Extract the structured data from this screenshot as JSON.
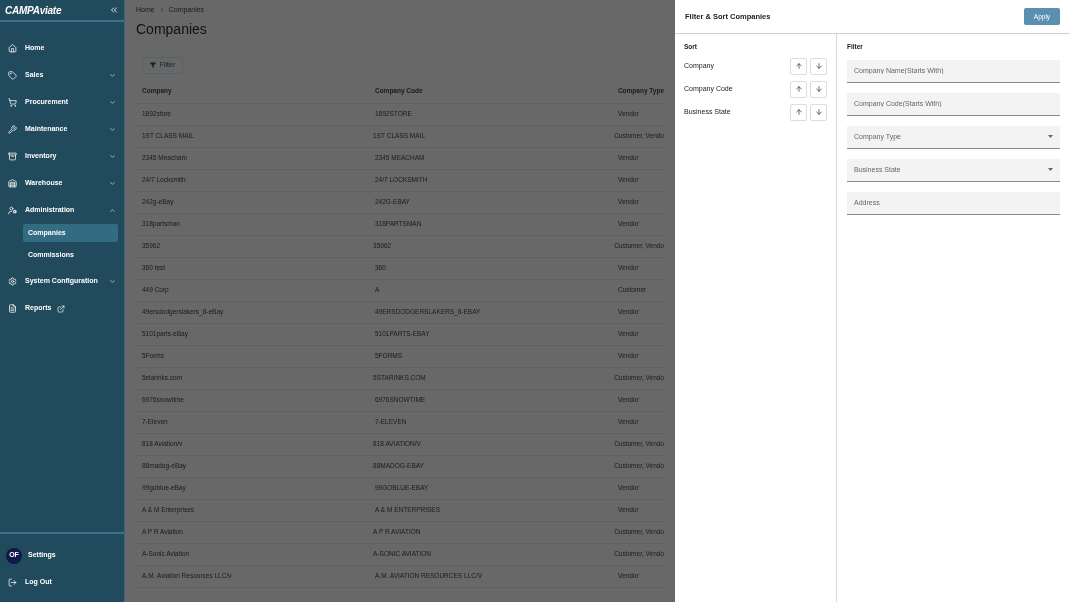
{
  "sidebar": {
    "logo": [
      "CAMP",
      "Aviate"
    ],
    "items": [
      {
        "label": "Home",
        "expandable": false,
        "external": false
      },
      {
        "label": "Sales",
        "expandable": true,
        "expanded": false
      },
      {
        "label": "Procurement",
        "expandable": true,
        "expanded": false
      },
      {
        "label": "Maintenance",
        "expandable": true,
        "expanded": false
      },
      {
        "label": "Inventory",
        "expandable": true,
        "expanded": false
      },
      {
        "label": "Warehouse",
        "expandable": true,
        "expanded": false
      },
      {
        "label": "Administration",
        "expandable": true,
        "expanded": true,
        "children": [
          {
            "label": "Companies",
            "selected": true
          },
          {
            "label": "Commissions",
            "selected": false
          }
        ]
      },
      {
        "label": "System Configuration",
        "expandable": true,
        "expanded": false
      },
      {
        "label": "Reports",
        "expandable": false,
        "external": true
      }
    ],
    "footer": {
      "avatar": "OF",
      "settings": "Settings",
      "logout": "Log Out"
    }
  },
  "breadcrumb": [
    "Home",
    "Companies"
  ],
  "page_title": "Companies",
  "filter_button": "Filter",
  "table": {
    "columns": [
      "Company",
      "Company Code",
      "Company Type"
    ],
    "rows": [
      [
        "1892store",
        "1892STORE",
        "Vendor"
      ],
      [
        "1ST CLASS MAIL",
        "1ST CLASS MAIL",
        "Customer, Vendo"
      ],
      [
        "2345 Meacham",
        "2345 MEACHAM",
        "Vendor"
      ],
      [
        "24/7 Locksmith",
        "24/7 LOCKSMITH",
        "Vendor"
      ],
      [
        "242g-eBay",
        "242G-EBAY",
        "Vendor"
      ],
      [
        "318partsman",
        "318PARTSMAN",
        "Vendor"
      ],
      [
        "35962",
        "35962",
        "Customer, Vendo"
      ],
      [
        "360 test",
        "360",
        "Vendor"
      ],
      [
        "449 Corp",
        "A",
        "Customer"
      ],
      [
        "49ersdodgerslakers_8-eBay",
        "49ERSDODGERSLAKERS_8-EBAY",
        "Vendor"
      ],
      [
        "5101parts-eBay",
        "5101PARTS-EBAY",
        "Vendor"
      ],
      [
        "5Forms",
        "5FORMS",
        "Vendor"
      ],
      [
        "5starinks.com",
        "5STARINKS.COM",
        "Customer, Vendo"
      ],
      [
        "6976snowtime",
        "6976SNOWTIME",
        "Vendor"
      ],
      [
        "7-Eleven",
        "7-ELEVEN",
        "Vendor"
      ],
      [
        "818 Aviation/v",
        "818 AVIATION/V",
        "Customer, Vendo"
      ],
      [
        "88madog-eBay",
        "88MADOG-EBAY",
        "Customer, Vendo"
      ],
      [
        "99goblue-eBay",
        "99GOBLUE-EBAY",
        "Vendor"
      ],
      [
        "A & M Enterprises",
        "A & M ENTERPRISES",
        "Vendor"
      ],
      [
        "A P R Aviation",
        "A P R AVIATION",
        "Customer, Vendo"
      ],
      [
        "A-Sonic Aviation",
        "A-SONIC AVIATION",
        "Customer, Vendo"
      ],
      [
        "A.M. Aviation Resources LLC/v",
        "A.M. AVIATION RESOURCES LLC/V",
        "Vendor"
      ]
    ]
  },
  "drawer": {
    "title": "Filter & Sort Companies",
    "apply": "Apply",
    "sort": {
      "heading": "Sort",
      "fields": [
        "Company",
        "Company Code",
        "Business State"
      ]
    },
    "filter": {
      "heading": "Filter",
      "fields": [
        {
          "kind": "text",
          "placeholder": "Company Name(Starts With)"
        },
        {
          "kind": "text",
          "placeholder": "Company Code(Starts With)"
        },
        {
          "kind": "select",
          "placeholder": "Company Type"
        },
        {
          "kind": "select",
          "placeholder": "Business State"
        },
        {
          "kind": "text",
          "placeholder": "Address"
        }
      ]
    }
  }
}
